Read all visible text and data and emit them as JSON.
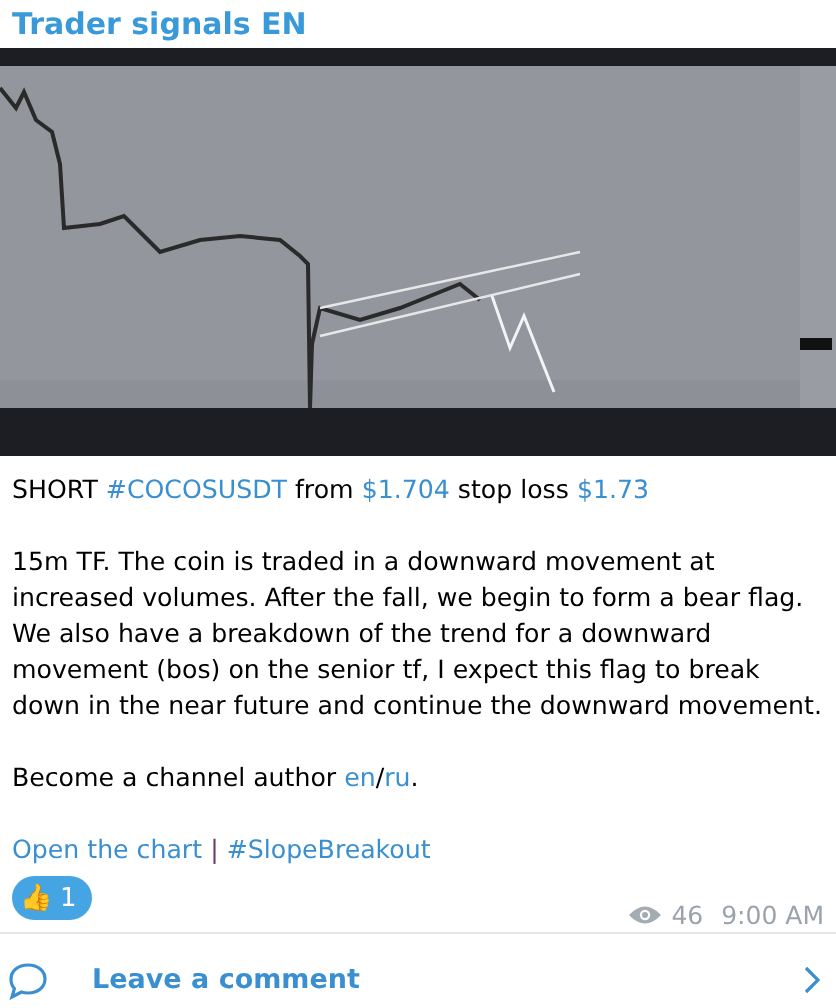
{
  "channel": {
    "title": "Trader signals EN"
  },
  "message": {
    "paragraphs": [
      [
        {
          "kind": "plain",
          "text": "SHORT "
        },
        {
          "kind": "link",
          "text": "#COCOSUSDT"
        },
        {
          "kind": "plain",
          "text": " from "
        },
        {
          "kind": "link",
          "text": "$1.704"
        },
        {
          "kind": "plain",
          "text": " stop loss "
        },
        {
          "kind": "link",
          "text": "$1.73"
        }
      ],
      [
        {
          "kind": "plain",
          "text": "15m TF. The coin is traded in a downward movement at increased volumes. After the fall, we begin to form a bear flag. We also have a breakdown of the trend for a downward movement (bos) on the senior tf, I expect this flag to break down in the near future and continue the downward movement."
        }
      ],
      [
        {
          "kind": "plain",
          "text": "Become a channel author "
        },
        {
          "kind": "link",
          "text": "en"
        },
        {
          "kind": "plain",
          "text": "/"
        },
        {
          "kind": "link",
          "text": "ru"
        },
        {
          "kind": "plain",
          "text": "."
        }
      ],
      [
        {
          "kind": "link",
          "text": "Open the chart"
        },
        {
          "kind": "separator",
          "text": " | "
        },
        {
          "kind": "link",
          "text": "#SlopeBreakout"
        }
      ]
    ]
  },
  "reactions": [
    {
      "emoji": "👍",
      "count": "1",
      "selected": true
    }
  ],
  "views": "46",
  "time": "9:00 AM",
  "comment": {
    "label": "Leave a comment"
  }
}
